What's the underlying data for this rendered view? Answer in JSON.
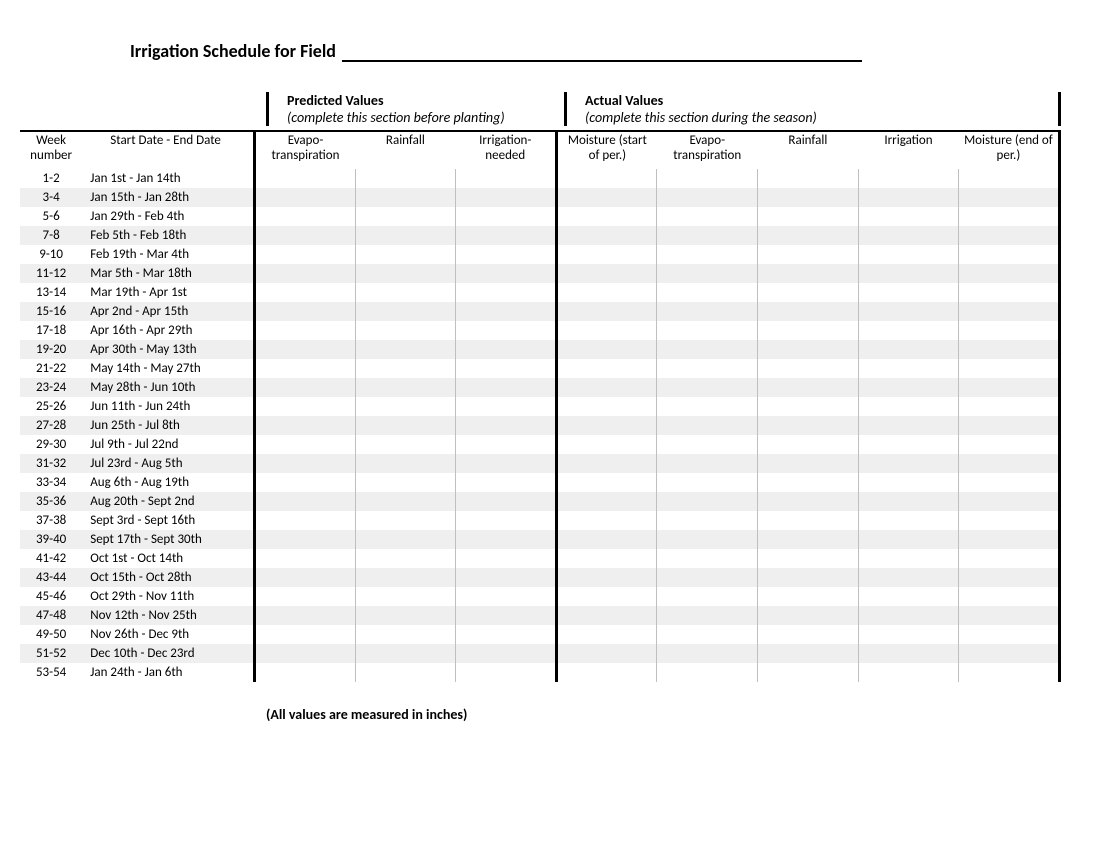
{
  "title": "Irrigation Schedule for Field",
  "section_predicted": {
    "title": "Predicted Values",
    "subtitle": "(complete this section before planting)"
  },
  "section_actual": {
    "title": "Actual Values",
    "subtitle": "(complete this section during the season)"
  },
  "columns": {
    "week": "Week number",
    "date_range": "Start Date - End Date",
    "pred_evapo": "Evapo-transpiration",
    "pred_rain": "Rainfall",
    "pred_irr": "Irrigation-needed",
    "act_moist_start": "Moisture (start of per.)",
    "act_evapo": "Evapo-transpiration",
    "act_rain": "Rainfall",
    "act_irr": "Irrigation",
    "act_moist_end": "Moisture (end of per.)"
  },
  "rows": [
    {
      "week": "1-2",
      "dates": "Jan 1st - Jan 14th"
    },
    {
      "week": "3-4",
      "dates": "Jan 15th - Jan 28th"
    },
    {
      "week": "5-6",
      "dates": "Jan 29th - Feb 4th"
    },
    {
      "week": "7-8",
      "dates": "Feb 5th - Feb 18th"
    },
    {
      "week": "9-10",
      "dates": "Feb 19th - Mar 4th"
    },
    {
      "week": "11-12",
      "dates": "Mar 5th - Mar 18th"
    },
    {
      "week": "13-14",
      "dates": "Mar 19th - Apr 1st"
    },
    {
      "week": "15-16",
      "dates": "Apr 2nd - Apr 15th"
    },
    {
      "week": "17-18",
      "dates": "Apr 16th - Apr 29th"
    },
    {
      "week": "19-20",
      "dates": "Apr 30th - May 13th"
    },
    {
      "week": "21-22",
      "dates": "May 14th - May 27th"
    },
    {
      "week": "23-24",
      "dates": "May 28th - Jun 10th"
    },
    {
      "week": "25-26",
      "dates": "Jun 11th - Jun 24th"
    },
    {
      "week": "27-28",
      "dates": "Jun 25th - Jul 8th"
    },
    {
      "week": "29-30",
      "dates": "Jul 9th - Jul 22nd"
    },
    {
      "week": "31-32",
      "dates": "Jul 23rd - Aug 5th"
    },
    {
      "week": "33-34",
      "dates": "Aug 6th - Aug 19th"
    },
    {
      "week": "35-36",
      "dates": "Aug 20th - Sept 2nd"
    },
    {
      "week": "37-38",
      "dates": "Sept 3rd - Sept 16th"
    },
    {
      "week": "39-40",
      "dates": "Sept 17th - Sept 30th"
    },
    {
      "week": "41-42",
      "dates": "Oct 1st - Oct 14th"
    },
    {
      "week": "43-44",
      "dates": "Oct 15th - Oct 28th"
    },
    {
      "week": "45-46",
      "dates": "Oct 29th - Nov 11th"
    },
    {
      "week": "47-48",
      "dates": "Nov 12th - Nov 25th"
    },
    {
      "week": "49-50",
      "dates": "Nov 26th - Dec 9th"
    },
    {
      "week": "51-52",
      "dates": "Dec 10th - Dec 23rd"
    },
    {
      "week": "53-54",
      "dates": "Jan 24th - Jan 6th"
    }
  ],
  "footer": "(All values are measured in inches)"
}
